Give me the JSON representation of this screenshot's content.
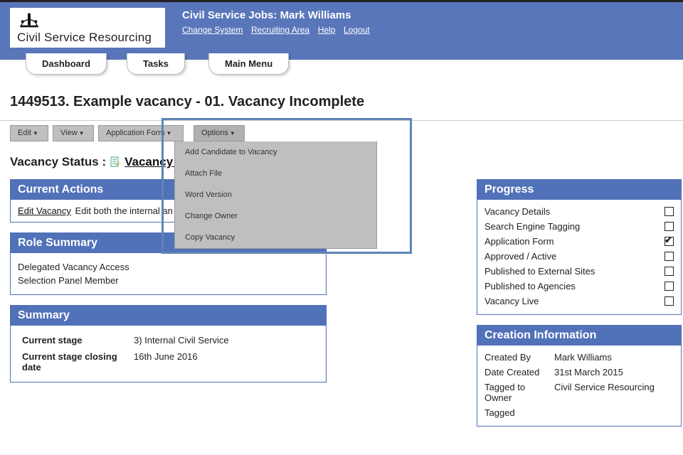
{
  "header": {
    "logo_text": "Civil Service Resourcing",
    "title": "Civil Service Jobs: Mark Williams",
    "links": {
      "change_system": "Change System",
      "recruiting_area": "Recruiting Area",
      "help": "Help",
      "logout": "Logout"
    }
  },
  "nav_tabs": {
    "dashboard": "Dashboard",
    "tasks": "Tasks",
    "main_menu": "Main Menu"
  },
  "page_title": "1449513. Example vacancy - 01. Vacancy Incomplete",
  "toolbar": {
    "edit": "Edit",
    "view": "View",
    "application_form": "Application Form",
    "options": "Options"
  },
  "options_menu": {
    "add_candidate": "Add Candidate to Vacancy",
    "attach_file": "Attach File",
    "word_version": "Word Version",
    "change_owner": "Change Owner",
    "copy_vacancy": "Copy Vacancy"
  },
  "vacancy_status": {
    "label": "Vacancy Status :",
    "value": "Vacancy In"
  },
  "current_actions": {
    "header": "Current Actions",
    "link": "Edit Vacancy",
    "text": "Edit both the internal an"
  },
  "role_summary": {
    "header": "Role Summary",
    "items": [
      "Delegated Vacancy Access",
      "Selection Panel Member"
    ]
  },
  "summary": {
    "header": "Summary",
    "rows": [
      {
        "k": "Current stage",
        "v": "3) Internal Civil Service"
      },
      {
        "k": "Current stage closing date",
        "v": "16th June 2016"
      }
    ]
  },
  "progress": {
    "header": "Progress",
    "items": [
      {
        "label": "Vacancy Details",
        "checked": false
      },
      {
        "label": "Search Engine Tagging",
        "checked": false
      },
      {
        "label": "Application Form",
        "checked": true
      },
      {
        "label": "Approved / Active",
        "checked": false
      },
      {
        "label": "Published to External Sites",
        "checked": false
      },
      {
        "label": "Published to Agencies",
        "checked": false
      },
      {
        "label": "Vacancy Live",
        "checked": false
      }
    ]
  },
  "creation_info": {
    "header": "Creation Information",
    "rows": [
      {
        "k": "Created By",
        "v": "Mark Williams"
      },
      {
        "k": "Date Created",
        "v": "31st March 2015"
      },
      {
        "k": "Tagged to Owner",
        "v": "Civil Service Resourcing"
      },
      {
        "k": "Tagged",
        "v": ""
      }
    ]
  }
}
